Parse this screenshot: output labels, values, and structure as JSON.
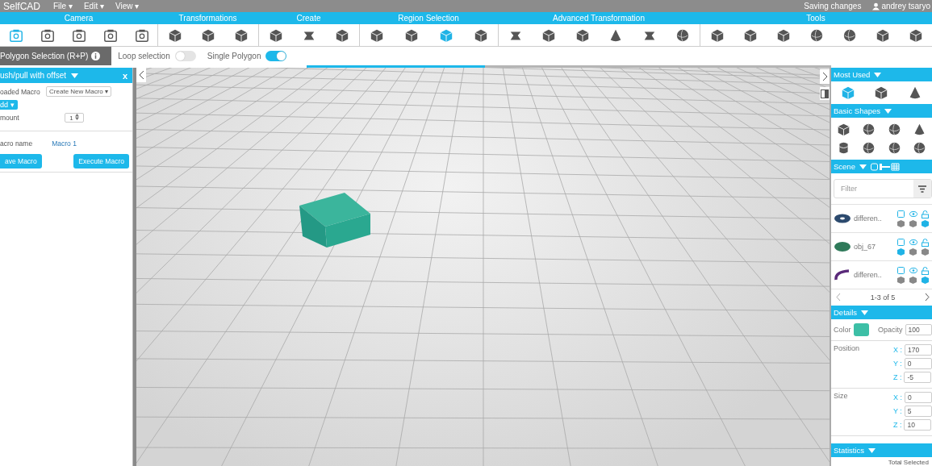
{
  "app": {
    "logo": "SelfCAD",
    "menus": [
      {
        "label": "File ▾"
      },
      {
        "label": "Edit ▾"
      },
      {
        "label": "View ▾"
      }
    ],
    "status": "Saving changes",
    "user": "andrey tsaryo"
  },
  "toolbar": [
    {
      "label": "Camera",
      "tools": [
        {
          "kind": "camera",
          "selected": true
        },
        {
          "kind": "camera",
          "selected": false
        },
        {
          "kind": "camera",
          "selected": false
        },
        {
          "kind": "camera",
          "selected": false
        },
        {
          "kind": "camera",
          "selected": false
        }
      ]
    },
    {
      "label": "Transformations",
      "tools": [
        {
          "kind": "cube",
          "selected": false
        },
        {
          "kind": "cube",
          "selected": false
        },
        {
          "kind": "cube",
          "selected": false
        }
      ]
    },
    {
      "label": "Create",
      "tools": [
        {
          "kind": "cube",
          "selected": false
        },
        {
          "kind": "slab",
          "selected": false
        },
        {
          "kind": "cube",
          "selected": false
        }
      ]
    },
    {
      "label": "Region Selection",
      "tools": [
        {
          "kind": "cube",
          "selected": false
        },
        {
          "kind": "cube",
          "selected": false
        },
        {
          "kind": "cube",
          "selected": true
        },
        {
          "kind": "cube",
          "selected": false
        }
      ]
    },
    {
      "label": "Advanced Transformation",
      "tools": [
        {
          "kind": "slab",
          "selected": false
        },
        {
          "kind": "cube",
          "selected": false
        },
        {
          "kind": "cube",
          "selected": false
        },
        {
          "kind": "cone",
          "selected": false
        },
        {
          "kind": "slab",
          "selected": false
        },
        {
          "kind": "sphere",
          "selected": false
        }
      ]
    },
    {
      "label": "Tools",
      "tools": [
        {
          "kind": "cube",
          "selected": false
        },
        {
          "kind": "cube",
          "selected": false
        },
        {
          "kind": "cube",
          "selected": false
        },
        {
          "kind": "sphere",
          "selected": false
        },
        {
          "kind": "sphere",
          "selected": false
        },
        {
          "kind": "cube",
          "selected": false
        },
        {
          "kind": "cube",
          "selected": false
        }
      ]
    }
  ],
  "options": {
    "mode": "Polygon Selection (R+P)",
    "toggles": [
      {
        "label": "Loop selection",
        "on": false
      },
      {
        "label": "Single Polygon",
        "on": true
      }
    ]
  },
  "progress": {
    "level": 0.34
  },
  "left_panel": {
    "title": "ush/pull with offset",
    "close": "x",
    "loaded_macro_label": "oaded Macro",
    "loaded_macro": "Create New Macro ▾",
    "add": "dd ▾",
    "amount_label": "mount",
    "amount": "1",
    "macro_name_label": "acro name",
    "macro_name": "Macro 1",
    "buttons": [
      "ave Macro",
      "Execute Macro"
    ]
  },
  "right_panel": {
    "most_used": {
      "title": "Most Used",
      "items": [
        {
          "kind": "cube",
          "selected": true
        },
        {
          "kind": "cube",
          "selected": false
        },
        {
          "kind": "cone",
          "selected": false
        }
      ]
    },
    "basic_shapes": {
      "title": "Basic Shapes",
      "items": [
        {
          "kind": "cube"
        },
        {
          "kind": "sphere"
        },
        {
          "kind": "sphere"
        },
        {
          "kind": "cone"
        },
        {
          "kind": "cylinder"
        },
        {
          "kind": "sphere"
        },
        {
          "kind": "sphere"
        },
        {
          "kind": "sphere"
        }
      ]
    },
    "scene": {
      "title": "Scene",
      "filter_placeholder": "Filter",
      "objects": [
        {
          "name": "differen..",
          "color": "#2c4a6e",
          "kind": "ring",
          "materials": [
            {
              "selected": false
            },
            {
              "selected": false
            },
            {
              "selected": true
            }
          ]
        },
        {
          "name": "obj_67",
          "color": "#2f7a5a",
          "kind": "disc",
          "materials": [
            {
              "selected": true
            },
            {
              "selected": false
            },
            {
              "selected": false
            }
          ]
        },
        {
          "name": "differen..",
          "color": "#5a2a7a",
          "kind": "arc",
          "materials": [
            {
              "selected": false
            },
            {
              "selected": false
            },
            {
              "selected": true
            }
          ]
        }
      ],
      "pager": "1-3 of 5"
    },
    "details": {
      "title": "Details",
      "color_label": "Color",
      "color": "#3dbfa6",
      "opacity_label": "Opacity",
      "opacity": "100",
      "groups": [
        {
          "label": "Position",
          "axes": [
            {
              "axis": "X :",
              "value": "170"
            },
            {
              "axis": "Y :",
              "value": "0"
            },
            {
              "axis": "Z :",
              "value": "-5"
            }
          ]
        },
        {
          "label": "Size",
          "axes": [
            {
              "axis": "X :",
              "value": "0"
            },
            {
              "axis": "Y :",
              "value": "5"
            },
            {
              "axis": "Z :",
              "value": "10"
            }
          ]
        }
      ]
    },
    "statistics": {
      "title": "Statistics",
      "columns": "Total  Selected"
    }
  }
}
